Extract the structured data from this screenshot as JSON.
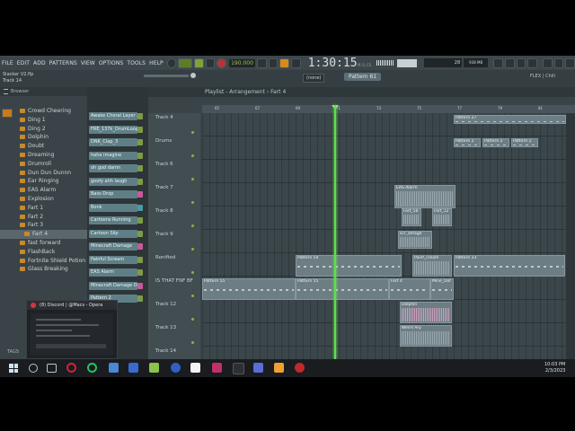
{
  "menu": [
    "FILE",
    "EDIT",
    "ADD",
    "PATTERNS",
    "VIEW",
    "OPTIONS",
    "TOOLS",
    "HELP"
  ],
  "tempo": "190.000",
  "clock": {
    "time": "1:30:15",
    "unit": "M:S:CS"
  },
  "cpu": {
    "value": "28",
    "mem": "938 MB"
  },
  "song": {
    "name": "Slacker V2.flp",
    "track": "Track 14"
  },
  "snap": "(none)",
  "pattern_selector": "Pattern 61",
  "flex_label": "FLEX | Chill",
  "browser": {
    "title": "Browser",
    "items": [
      {
        "label": "Crowd Cheering",
        "folder": true
      },
      {
        "label": "Ding 1",
        "folder": true
      },
      {
        "label": "Ding 2",
        "folder": true
      },
      {
        "label": "Dolphin",
        "folder": true
      },
      {
        "label": "Doubt",
        "folder": true
      },
      {
        "label": "Dreaming",
        "folder": true
      },
      {
        "label": "Drumroll",
        "folder": true
      },
      {
        "label": "Dun Dun Dunnn",
        "folder": true
      },
      {
        "label": "Ear Ringing",
        "folder": true
      },
      {
        "label": "EAS Alarm",
        "folder": true
      },
      {
        "label": "Explosion",
        "folder": true
      },
      {
        "label": "Fart 1",
        "folder": true
      },
      {
        "label": "Fart 2",
        "folder": true
      },
      {
        "label": "Fart 3",
        "folder": true
      },
      {
        "label": "Fart 4",
        "folder": true,
        "selected": true
      },
      {
        "label": "fast forward",
        "folder": true
      },
      {
        "label": "FlashBack",
        "folder": true
      },
      {
        "label": "Fortnite Shield Potion",
        "folder": true
      },
      {
        "label": "Glass Breaking",
        "folder": true
      }
    ]
  },
  "channel_rack": [
    {
      "label": "Awake Choral Layer 2",
      "sw": "green"
    },
    {
      "label": "FRE_137k_DrumLoop_",
      "sw": "green"
    },
    {
      "label": "DNK_Clap_3",
      "sw": "green"
    },
    {
      "label": "haha imagine",
      "sw": "green"
    },
    {
      "label": "oh god damn",
      "sw": "green"
    },
    {
      "label": "goofy ahh laugh",
      "sw": "green"
    },
    {
      "label": "Bass Drop",
      "sw": "pink"
    },
    {
      "label": "Bonk",
      "sw": "teal"
    },
    {
      "label": "Cartoons Running",
      "sw": "green"
    },
    {
      "label": "Cartoon Slip",
      "sw": "green"
    },
    {
      "label": "Minecraft Damage",
      "sw": "pink"
    },
    {
      "label": "Painful Scream",
      "sw": "green"
    },
    {
      "label": "EAS Alarm",
      "sw": "green"
    },
    {
      "label": "Minecraft Damage Oof",
      "sw": "pink"
    },
    {
      "label": "Pattern 2",
      "sw": "green"
    }
  ],
  "playlist": {
    "title": "Playlist - Arrangement",
    "current": "Fart 4",
    "ruler": [
      "65",
      "67",
      "69",
      "71",
      "73",
      "75",
      "77",
      "79",
      "81"
    ],
    "tracks": [
      "Track 4",
      "Drums",
      "Track 6",
      "Track 7",
      "Track 8",
      "Track 9",
      "Ronified",
      "IS THAT FNF BF",
      "Track 12",
      "Track 13",
      "Track 14"
    ],
    "clips": [
      {
        "label": "Pattern 27"
      },
      {
        "label": "Pattern 2"
      },
      {
        "label": "Pattern 2"
      },
      {
        "label": "Pattern 2"
      },
      {
        "label": "EAS Alarm"
      },
      {
        "label": "Fart_5b"
      },
      {
        "label": "Fart_12"
      },
      {
        "label": "scr_amage"
      },
      {
        "label": "Pattern 54"
      },
      {
        "label": "Painf_cream"
      },
      {
        "label": "Pattern 23"
      },
      {
        "label": "Pattern 55"
      },
      {
        "label": "Pattern 55"
      },
      {
        "label": "Fart 4"
      },
      {
        "label": "Mine_Oof"
      },
      {
        "label": "Dolphin"
      },
      {
        "label": "Weird Ary"
      }
    ]
  },
  "discord": {
    "title": "(8) Discord | @Macs - Opera"
  },
  "tags_label": "TAGS",
  "taskbar": {
    "time": "10:03 PM",
    "date": "2/3/2023"
  },
  "colors": {
    "accent_green": "#5ee04a",
    "clip": "#6c7d84",
    "folder": "#c9892a",
    "background": "#3a4448"
  }
}
